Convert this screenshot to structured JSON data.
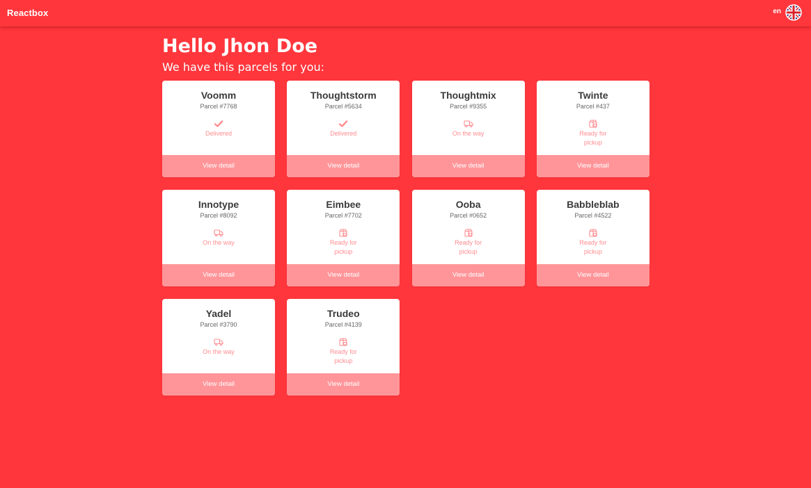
{
  "header": {
    "brand": "Reactbox",
    "language": "en",
    "language_flag_icon": "uk-flag-icon"
  },
  "greeting": "Hello Jhon Doe",
  "subtitle": "We have this parcels for you:",
  "colors": {
    "background": "#ff363c",
    "card": "#ffffff",
    "button": "#ff9599",
    "status": "#ff8c91",
    "text": "#3a3a3a"
  },
  "button_label": "View detail",
  "parcels": [
    {
      "name": "Voomm",
      "number": "Parcel #7768",
      "status": "Delivered",
      "icon": "check-icon"
    },
    {
      "name": "Thoughtstorm",
      "number": "Parcel #5634",
      "status": "Delivered",
      "icon": "check-icon"
    },
    {
      "name": "Thoughtmix",
      "number": "Parcel #9355",
      "status": "On the way",
      "icon": "truck-icon"
    },
    {
      "name": "Twinte",
      "number": "Parcel #437",
      "status": "Ready for pickup",
      "icon": "package-icon"
    },
    {
      "name": "Innotype",
      "number": "Parcel #8092",
      "status": "On the way",
      "icon": "truck-icon"
    },
    {
      "name": "Eimbee",
      "number": "Parcel #7702",
      "status": "Ready for pickup",
      "icon": "package-icon"
    },
    {
      "name": "Ooba",
      "number": "Parcel #0652",
      "status": "Ready for pickup",
      "icon": "package-icon"
    },
    {
      "name": "Babbleblab",
      "number": "Parcel #4522",
      "status": "Ready for pickup",
      "icon": "package-icon"
    },
    {
      "name": "Yadel",
      "number": "Parcel #3790",
      "status": "On the way",
      "icon": "truck-icon"
    },
    {
      "name": "Trudeo",
      "number": "Parcel #4139",
      "status": "Ready for pickup",
      "icon": "package-icon"
    }
  ]
}
